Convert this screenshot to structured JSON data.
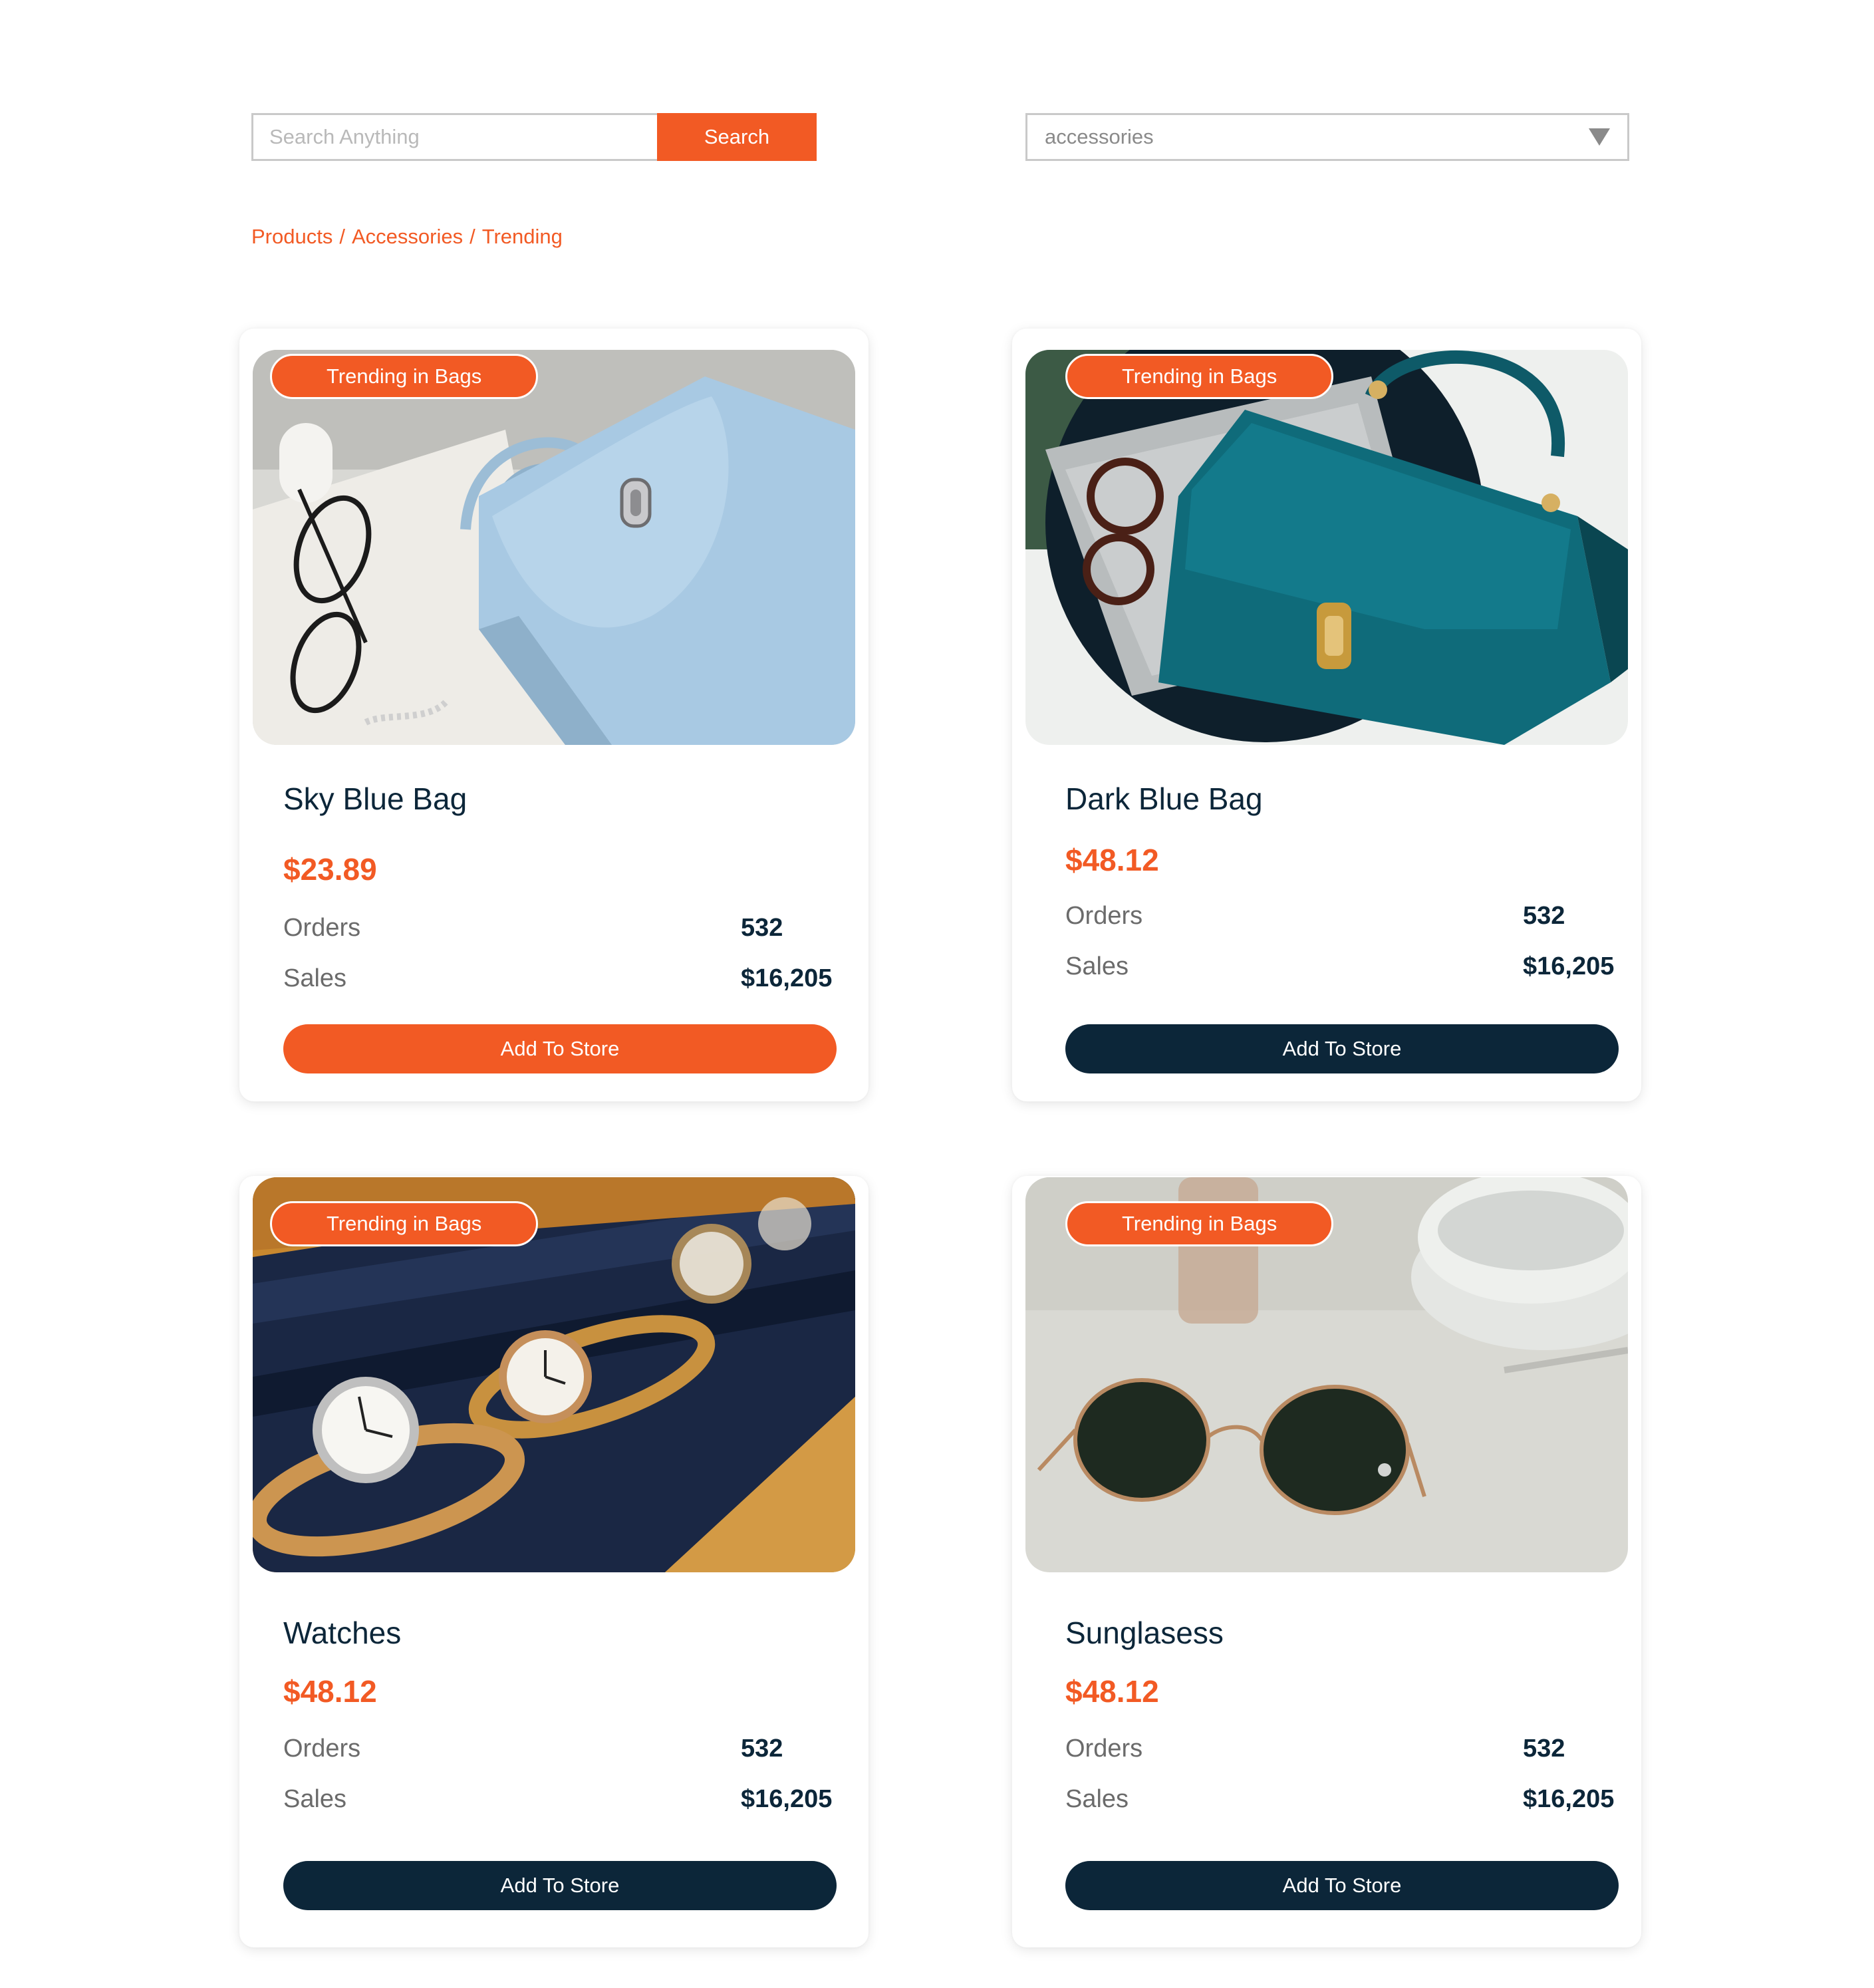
{
  "search": {
    "placeholder": "Search Anything",
    "button_label": "Search"
  },
  "category": {
    "selected": "accessories",
    "icon": "caret-down-icon"
  },
  "breadcrumb": [
    "Products",
    "/",
    "Accessories",
    "/",
    "Trending"
  ],
  "colors": {
    "accent": "#f25a24",
    "navy": "#0c2639",
    "muted": "#6b6b6b"
  },
  "products": [
    {
      "badge": "Trending in Bags",
      "name": "Sky Blue Bag",
      "price": "$23.89",
      "orders_label": "Orders",
      "orders": "532",
      "sales_label": "Sales",
      "sales": "$16,205",
      "button": "Add To Store"
    },
    {
      "badge": "Trending in Bags",
      "name": "Dark Blue Bag",
      "price": "$48.12",
      "orders_label": "Orders",
      "orders": "532",
      "sales_label": "Sales",
      "sales": "$16,205",
      "button": "Add To Store"
    },
    {
      "badge": "Trending in Bags",
      "name": "Watches",
      "price": "$48.12",
      "orders_label": "Orders",
      "orders": "532",
      "sales_label": "Sales",
      "sales": "$16,205",
      "button": "Add To Store"
    },
    {
      "badge": "Trending in Bags",
      "name": "Sunglasess",
      "price": "$48.12",
      "orders_label": "Orders",
      "orders": "532",
      "sales_label": "Sales",
      "sales": "$16,205",
      "button": "Add To Store"
    }
  ]
}
